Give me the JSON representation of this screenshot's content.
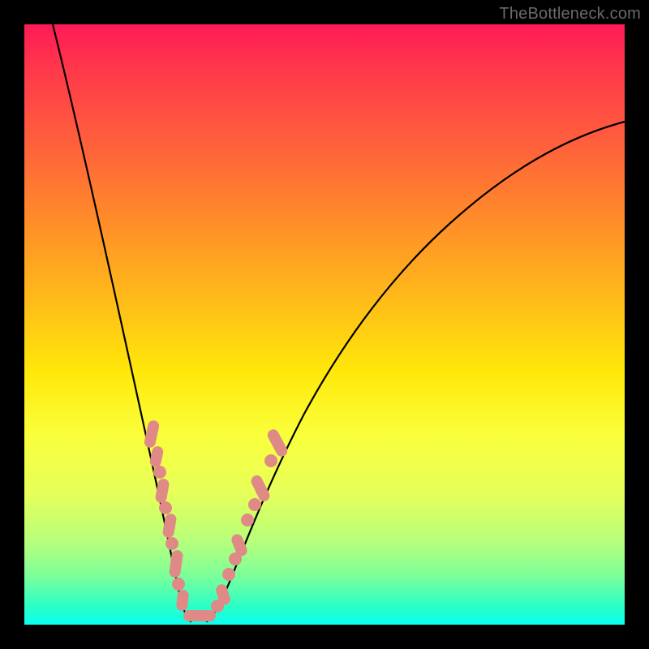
{
  "watermark": "TheBottleneck.com",
  "colors": {
    "dot": "#e08a88",
    "curve": "#000000",
    "frame_bg_top": "#ff1a56",
    "frame_bg_bottom": "#0affee",
    "page_bg": "#000000",
    "watermark": "#6a6a6a"
  },
  "chart_data": {
    "type": "line",
    "title": "",
    "xlabel": "",
    "ylabel": "",
    "xlim": [
      0,
      100
    ],
    "ylim": [
      0,
      100
    ],
    "grid": false,
    "legend": false,
    "notes": "Axes unlabeled. y ≈ bottleneck percentage (0 at bottom/green, 100 at top/red). x ≈ component balance ratio. Curve is a V with vertex near x≈24, y≈0; left branch steep, right branch shallower asymptoting near y≈77. Salmon markers cluster along both branches near the vertex, roughly y∈[2,35].",
    "series": [
      {
        "name": "bottleneck-curve",
        "x": [
          4,
          6,
          8,
          10,
          12,
          14,
          16,
          18,
          20,
          21.5,
          23,
          24,
          25,
          26.5,
          28,
          30,
          32,
          35,
          38,
          42,
          47,
          53,
          60,
          68,
          77,
          87,
          100
        ],
        "y": [
          100,
          91,
          82,
          72,
          62,
          52,
          42,
          32,
          21,
          14,
          7,
          2,
          2,
          6,
          12,
          20,
          27,
          35,
          41,
          48,
          54,
          60,
          65,
          69,
          72,
          75,
          77
        ]
      }
    ],
    "markers": {
      "name": "highlighted-points",
      "color": "#e08a88",
      "points": [
        {
          "x": 18.0,
          "y": 34
        },
        {
          "x": 18.7,
          "y": 30
        },
        {
          "x": 19.3,
          "y": 26
        },
        {
          "x": 19.8,
          "y": 23
        },
        {
          "x": 20.4,
          "y": 19
        },
        {
          "x": 21.0,
          "y": 15
        },
        {
          "x": 21.6,
          "y": 12
        },
        {
          "x": 22.4,
          "y": 8
        },
        {
          "x": 23.2,
          "y": 5
        },
        {
          "x": 24.0,
          "y": 3
        },
        {
          "x": 25.0,
          "y": 2
        },
        {
          "x": 26.2,
          "y": 3
        },
        {
          "x": 27.2,
          "y": 6
        },
        {
          "x": 28.2,
          "y": 10
        },
        {
          "x": 29.0,
          "y": 14
        },
        {
          "x": 29.8,
          "y": 18
        },
        {
          "x": 30.8,
          "y": 22
        },
        {
          "x": 32.2,
          "y": 27
        },
        {
          "x": 33.6,
          "y": 31
        },
        {
          "x": 35.0,
          "y": 35
        }
      ]
    }
  }
}
